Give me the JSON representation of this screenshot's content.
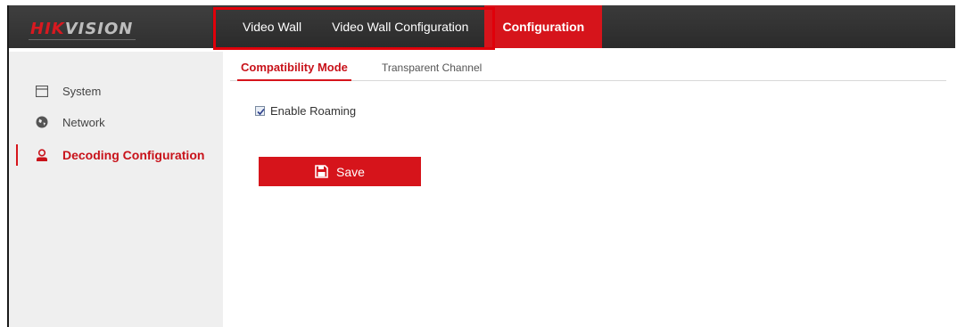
{
  "brand": {
    "logo_hik": "HIK",
    "logo_vision": "VISION"
  },
  "nav": {
    "items": [
      {
        "label": "Video Wall"
      },
      {
        "label": "Video Wall Configuration"
      },
      {
        "label": "Configuration"
      }
    ],
    "active": "Configuration"
  },
  "sidebar": {
    "items": [
      {
        "label": "System",
        "icon": "system-window-icon"
      },
      {
        "label": "Network",
        "icon": "network-globe-icon"
      },
      {
        "label": "Decoding Configuration",
        "icon": "decoding-user-icon"
      }
    ],
    "active": "Decoding Configuration"
  },
  "tabs": [
    {
      "label": "Compatibility Mode"
    },
    {
      "label": "Transparent Channel"
    }
  ],
  "form": {
    "enable_roaming_label": "Enable Roaming",
    "enable_roaming_checked": true
  },
  "save_label": "Save",
  "colors": {
    "accent": "#d6141b",
    "header": "#2e2e2e",
    "sidebar": "#efefef"
  }
}
